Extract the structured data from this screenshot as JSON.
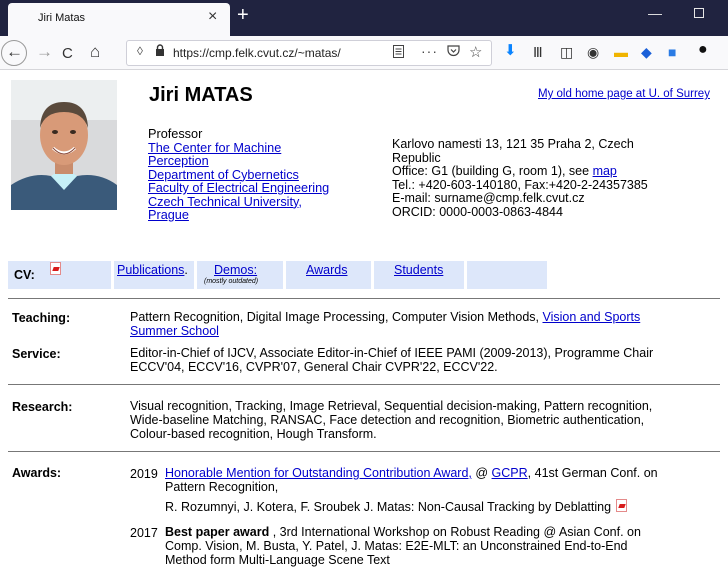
{
  "browser": {
    "tab_title": "Jiri Matas",
    "tab_close": "×",
    "new_tab": "+",
    "minimize": "—",
    "url": "https://cmp.felk.cvut.cz/~matas/",
    "back": "←",
    "forward": "→",
    "reload": "C",
    "home": "⌂",
    "more": "···",
    "star": "☆",
    "download": "⬇",
    "library": "Ⅲ",
    "sidebar": "◫",
    "tb_icon_1": "◉",
    "tb_icon_2": "▬",
    "tb_icon_3": "◆",
    "tb_icon_4": "■",
    "tb_icon_5": "●"
  },
  "header": {
    "name": "Jiri MATAS",
    "old_home_link": "My old home page at U. of Surrey"
  },
  "affiliation": {
    "title": "Professor",
    "cmp_line1": "The Center for Machine",
    "cmp_line2": "Perception",
    "dept": "Department of Cybernetics",
    "faculty": "Faculty of Electrical Engineering",
    "ctu_line1": "Czech Technical University,",
    "ctu_line2": "Prague"
  },
  "address": {
    "line1": "Karlovo namesti 13, 121 35 Praha 2, Czech",
    "line2": "Republic",
    "office_prefix": "Office: G1 (building G, room 1), see ",
    "map_link": "map",
    "tel": "Tel.: +420-603-140180, Fax:+420-2-24357385",
    "email": "E-mail: surname@cmp.felk.cvut.cz",
    "orcid": "ORCID: 0000-0003-0863-4844"
  },
  "cvbar": {
    "cv_label": "CV:",
    "publications": "Publications",
    "publications_dot": ".",
    "demos": "Demos:",
    "demos_note": "(mostly outdated)",
    "awards": "Awards",
    "students": "Students"
  },
  "teaching": {
    "label": "Teaching:",
    "text": "Pattern Recognition, Digital Image Processing, Computer Vision Methods, ",
    "link_line1": "Vision and Sports",
    "link_line2": "Summer School"
  },
  "service": {
    "label": "Service:",
    "line1": "Editor-in-Chief of IJCV, Associate Editor-in-Chief of IEEE PAMI (2009-2013), Programme Chair",
    "line2": "ECCV'04, ECCV'16, CVPR'07, General Chair CVPR'22, ECCV'22."
  },
  "research": {
    "label": "Research:",
    "line1": "Visual recognition, Tracking, Image Retrieval, Sequential decision-making, Pattern recognition,",
    "line2": "Wide-baseline Matching, RANSAC, Face detection and recognition, Biometric authentication,",
    "line3": "Colour-based recognition, Hough Transform."
  },
  "awards": {
    "label": "Awards:",
    "items": [
      {
        "year": "2019",
        "link": "Honorable Mention for Outstanding Contribution Award,",
        "at": " @ ",
        "gcpr": "GCPR",
        "rest": ", 41st German Conf. on",
        "line2": "Pattern Recognition,",
        "line3": "R. Rozumnyi, J. Kotera, F. Sroubek J. Matas: Non-Causal Tracking by Deblatting"
      },
      {
        "year": "2017",
        "bold": "Best paper award",
        "line1_rest": " , 3rd International Workshop on Robust Reading @ Asian Conf. on",
        "line2": "Comp. Vision, M. Busta, Y. Patel, J. Matas: E2E-MLT: an Unconstrained End-to-End",
        "line3": "Method form Multi-Language Scene Text"
      }
    ]
  }
}
